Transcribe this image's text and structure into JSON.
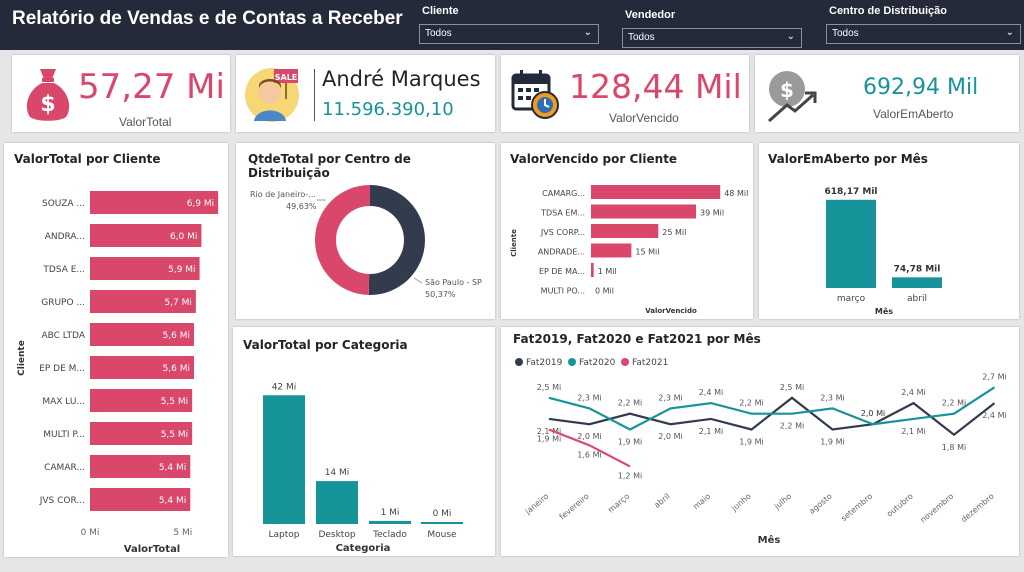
{
  "header": {
    "title": "Relatório de Vendas e de Contas a Receber"
  },
  "filters": [
    {
      "label": "Cliente",
      "value": "Todos"
    },
    {
      "label": "Vendedor",
      "value": "Todos"
    },
    {
      "label": "Centro de Distribuição",
      "value": "Todos"
    }
  ],
  "kpis": {
    "valor_total": {
      "value": "57,27 Mi",
      "label": "ValorTotal"
    },
    "vendedor": {
      "name": "André Marques",
      "value": "11.596.390,10",
      "sale_sign": "SALE"
    },
    "valor_vencido": {
      "value": "128,44 Mil",
      "label": "ValorVencido"
    },
    "valor_em_aberto": {
      "value": "692,94 Mil",
      "label": "ValorEmAberto"
    }
  },
  "colors": {
    "pink": "#d9486a",
    "teal": "#17939a",
    "dark": "#323c4e",
    "header": "#252a3a"
  },
  "icons": {
    "money_bag": "money-bag-icon",
    "avatar": "salesperson-avatar-icon",
    "calendar": "calendar-clock-icon",
    "coin": "coin-growth-icon"
  },
  "chart_data": [
    {
      "type": "bar",
      "orientation": "horizontal",
      "title": "ValorTotal por Cliente",
      "xlabel": "ValorTotal",
      "ylabel": "Cliente",
      "categories": [
        "SOUZA ...",
        "ANDRA...",
        "TDSA E...",
        "GRUPO ...",
        "ABC LTDA",
        "EP DE M...",
        "MAX LU...",
        "MULTI P...",
        "CAMAR...",
        "JVS COR..."
      ],
      "values": [
        6.9,
        6.0,
        5.9,
        5.7,
        5.6,
        5.6,
        5.5,
        5.5,
        5.4,
        5.4
      ],
      "data_labels": [
        "6,9 Mi",
        "6,0 Mi",
        "5,9 Mi",
        "5,7 Mi",
        "5,6 Mi",
        "5,6 Mi",
        "5,5 Mi",
        "5,5 Mi",
        "5,4 Mi",
        "5,4 Mi"
      ],
      "xticks": [
        "0 Mi",
        "5 Mi"
      ],
      "xlim": [
        0,
        7
      ]
    },
    {
      "type": "pie",
      "variant": "donut",
      "title": "QtdeTotal por Centro de Distribuição",
      "slices": [
        {
          "name": "Rio de Janeiro-...",
          "value": 49.63,
          "label": "49,63%"
        },
        {
          "name": "São Paulo - SP",
          "value": 50.37,
          "label": "50,37%"
        }
      ]
    },
    {
      "type": "bar",
      "orientation": "horizontal",
      "title": "ValorVencido por Cliente",
      "xlabel": "ValorVencido",
      "ylabel": "Cliente",
      "categories": [
        "CAMARG...",
        "TDSA EM...",
        "JVS CORP...",
        "ANDRADE...",
        "EP DE MA...",
        "MULTI PO..."
      ],
      "values": [
        48,
        39,
        25,
        15,
        1,
        0
      ],
      "data_labels": [
        "48 Mil",
        "39 Mil",
        "25 Mil",
        "15 Mil",
        "1 Mil",
        "0 Mil"
      ],
      "xlim": [
        0,
        52
      ]
    },
    {
      "type": "bar",
      "title": "ValorEmAberto por Mês",
      "xlabel": "Mês",
      "categories": [
        "março",
        "abril"
      ],
      "values": [
        618.17,
        74.78
      ],
      "data_labels": [
        "618,17 Mil",
        "74,78 Mil"
      ],
      "ylim": [
        0,
        660
      ]
    },
    {
      "type": "bar",
      "title": "ValorTotal por Categoria",
      "xlabel": "Categoria",
      "categories": [
        "Laptop",
        "Desktop",
        "Teclado",
        "Mouse"
      ],
      "values": [
        42,
        14,
        1,
        0
      ],
      "data_labels": [
        "42 Mi",
        "14 Mi",
        "1 Mi",
        "0 Mi"
      ],
      "ylim": [
        0,
        46
      ]
    },
    {
      "type": "line",
      "title": "Fat2019, Fat2020 e Fat2021 por Mês",
      "xlabel": "Mês",
      "categories": [
        "janeiro",
        "fevereiro",
        "março",
        "abril",
        "maio",
        "junho",
        "julho",
        "agosto",
        "setembro",
        "outubro",
        "novembro",
        "dezembro"
      ],
      "ylim": [
        1.0,
        2.8
      ],
      "series": [
        {
          "name": "Fat2019",
          "color": "#323c4e",
          "values": [
            2.1,
            2.0,
            2.2,
            2.0,
            2.1,
            1.9,
            2.5,
            1.9,
            2.0,
            2.4,
            1.8,
            2.4
          ],
          "labels": [
            "2,1 Mi",
            "2,0 Mi",
            "2,2 Mi",
            "2,0 Mi",
            "2,1 Mi",
            "1,9 Mi",
            "2,5 Mi",
            "1,9 Mi",
            "2,0 Mi",
            "2,4 Mi",
            "1,8 Mi",
            "2,4 Mi"
          ]
        },
        {
          "name": "Fat2020",
          "color": "#17939a",
          "values": [
            2.5,
            2.3,
            1.9,
            2.3,
            2.4,
            2.2,
            2.2,
            2.3,
            2.0,
            2.1,
            2.2,
            2.7
          ],
          "labels": [
            "2,5 Mi",
            "2,3 Mi",
            "1,9 Mi",
            "2,3 Mi",
            "2,4 Mi",
            "2,2 Mi",
            "2,2 Mi",
            "2,3 Mi",
            "2,0 Mi",
            "2,1 Mi",
            "2,2 Mi",
            "2,7 Mi"
          ]
        },
        {
          "name": "Fat2021",
          "color": "#d9486a",
          "values": [
            1.9,
            1.6,
            1.2
          ],
          "labels": [
            "1,9 Mi",
            "1,6 Mi",
            "1,2 Mi"
          ]
        }
      ]
    }
  ]
}
